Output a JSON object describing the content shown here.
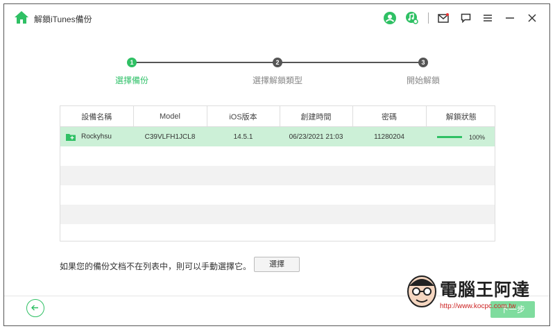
{
  "app": {
    "title": "解鎖iTunes備份",
    "accent_color": "#2fc064"
  },
  "titlebar_icons": [
    "user-icon",
    "music-search-icon",
    "mail-icon",
    "feedback-icon",
    "menu-icon",
    "minimize-icon",
    "close-icon"
  ],
  "steps": [
    {
      "number": "1",
      "label": "選擇備份",
      "state": "active"
    },
    {
      "number": "2",
      "label": "選擇解鎖類型",
      "state": "inactive"
    },
    {
      "number": "3",
      "label": "開始解鎖",
      "state": "inactive"
    }
  ],
  "table": {
    "columns": [
      "設備名稱",
      "Model",
      "iOS版本",
      "創建時間",
      "密碼",
      "解鎖狀態"
    ],
    "rows": [
      {
        "name": "Rockyhsu",
        "model": "C39VLFH1JCL8",
        "ios": "14.5.1",
        "created": "06/23/2021 21:03",
        "password": "11280204",
        "progress": 100,
        "progress_label": "100%"
      }
    ]
  },
  "footer": {
    "prompt": "如果您的備份文档不在列表中，則可以手動選擇它。",
    "choose_label": "選擇",
    "next_label": "下一步"
  },
  "watermark": {
    "text": "電腦王阿達",
    "url": "http://www.kocpc.com.tw"
  }
}
